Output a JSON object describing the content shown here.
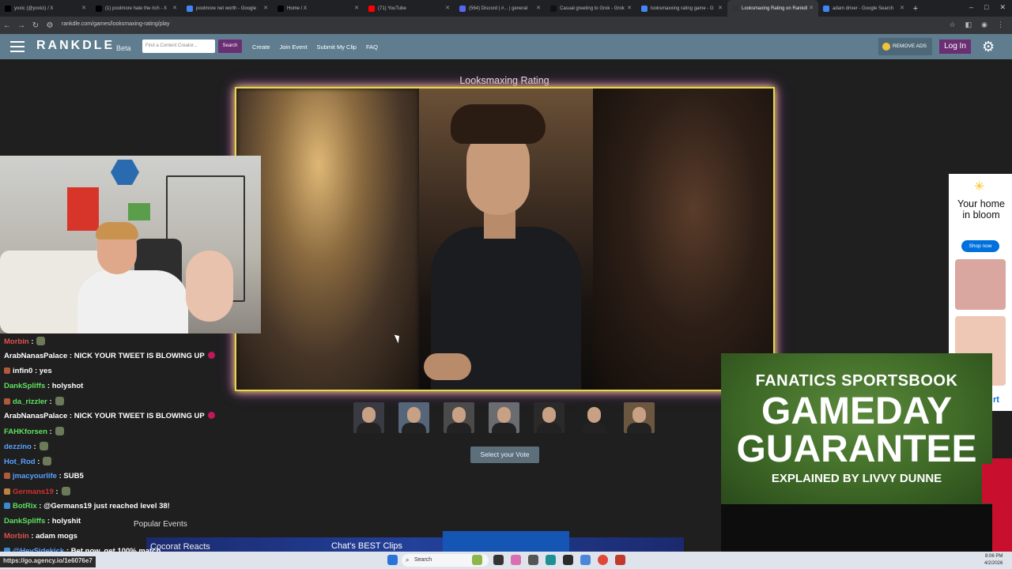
{
  "browser": {
    "tabs": [
      {
        "label": "yoxic (@yoxici) / X",
        "color": "#000000",
        "active": false
      },
      {
        "label": "(1) poolmore hate the rich - X",
        "color": "#000000",
        "active": false
      },
      {
        "label": "poolmore net worth - Google",
        "color": "#4285f4",
        "active": false
      },
      {
        "label": "Home / X",
        "color": "#000000",
        "active": false
      },
      {
        "label": "(71) YouTube",
        "color": "#ff0000",
        "active": false
      },
      {
        "label": "(564) Discord | #... | general",
        "color": "#5865f2",
        "active": false
      },
      {
        "label": "Casual greeting to Grok - Grok",
        "color": "#111111",
        "active": false
      },
      {
        "label": "looksmaxxing rating game - G",
        "color": "#4285f4",
        "active": false
      },
      {
        "label": "Looksmaxing Rating on Rankdl",
        "color": "#333333",
        "active": true
      },
      {
        "label": "adam driver - Google Search",
        "color": "#4285f4",
        "active": false
      }
    ],
    "new_tab": "+",
    "url": "rankdle.com/games/looksmaxing-rating/play"
  },
  "site": {
    "logo": "RANKDLE",
    "beta": "Beta",
    "search_placeholder": "Find a Content Creator...",
    "search_button": "Search",
    "nav": [
      "Create",
      "Join Event",
      "Submit My Clip",
      "FAQ"
    ],
    "remove_ads": "REMOVE ADS",
    "login": "Log In"
  },
  "game": {
    "title": "Looksmaxing Rating",
    "thumbnail_count": 7,
    "vote_button": "Select your Vote"
  },
  "bottom": {
    "popular_events": "Popular Events",
    "clip1": "Cocorat Reacts",
    "clip2": "Chat's BEST Clips"
  },
  "chat": [
    {
      "user": "Morbin",
      "color": "#e05050",
      "msg": ":",
      "emote": true
    },
    {
      "user": "ArabNanasPalace",
      "color": "#ffffff",
      "msg": ": NICK YOUR TWEET IS BLOWING UP",
      "heart": true
    },
    {
      "user": "infin0",
      "color": "#ffffff",
      "msg": ": yes",
      "badge": "#b05a3a"
    },
    {
      "user": "DankSpliffs",
      "color": "#5fe05f",
      "msg": ": holyshot"
    },
    {
      "user": "da_rizzler",
      "color": "#5fe05f",
      "msg": ":",
      "emote": true,
      "badge": "#b05a3a"
    },
    {
      "user": "ArabNanasPalace",
      "color": "#ffffff",
      "msg": ": NICK YOUR TWEET IS BLOWING UP",
      "heart": true
    },
    {
      "user": "FAHKforsen",
      "color": "#5fe05f",
      "msg": ":",
      "emote": true
    },
    {
      "user": "dezzino",
      "color": "#5aa0ff",
      "msg": ":",
      "emote": true
    },
    {
      "user": "Hot_Rod",
      "color": "#5aa0ff",
      "msg": ":",
      "emote": true
    },
    {
      "user": "jmacyourlife",
      "color": "#5aa0ff",
      "msg": ": SUB5",
      "badge": "#b05a3a"
    },
    {
      "user": "Germans19",
      "color": "#d03030",
      "msg": ":",
      "emote": true,
      "badge": "#c08040"
    },
    {
      "user": "BotRix",
      "color": "#5fe05f",
      "msg": ": @Germans19 just reached level 38!",
      "badge": "#3a8ad0"
    },
    {
      "user": "DankSpliffs",
      "color": "#5fe05f",
      "msg": ": holyshit"
    },
    {
      "user": "Morbin",
      "color": "#e05050",
      "msg": ": adam mogs"
    },
    {
      "user": "@HeySidekick",
      "color": "#5aa0ff",
      "msg": ": Bet now, get 100% match...",
      "badge": "#3a8ad0"
    }
  ],
  "ads": {
    "walmart_headline": "Your home in bloom",
    "walmart_cta": "Shop now",
    "walmart_edge": "rt",
    "fanatics_line1": "FANATICS SPORTSBOOK",
    "fanatics_line2a": "GAMEDAY",
    "fanatics_line2b": "GUARANTEE",
    "fanatics_line3": "EXPLAINED BY LIVVY DUNNE"
  },
  "status_link": "https://go.agency.io/1e6076e7",
  "taskbar": {
    "search": "Search",
    "time": "8:06 PM",
    "date": "4/2/2026"
  }
}
